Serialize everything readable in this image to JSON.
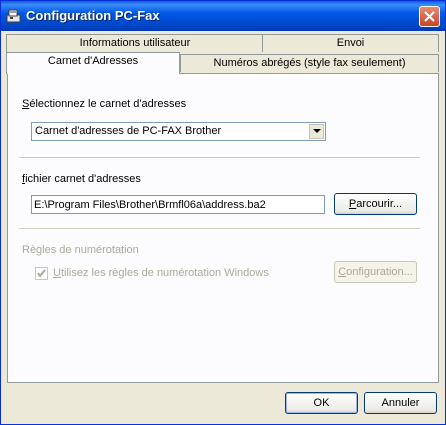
{
  "window": {
    "title": "Configuration PC-Fax",
    "close_label": "✕"
  },
  "tabs": {
    "row1": [
      "Informations utilisateur",
      "Envoi"
    ],
    "row2": [
      "Carnet d'Adresses",
      "Numéros abrégés (style fax seulement)"
    ],
    "active": "Carnet d'Adresses"
  },
  "address_book": {
    "select_label_first": "S",
    "select_label_rest": "électionnez le carnet d'adresses",
    "selected_value": "Carnet d'adresses de PC-FAX Brother",
    "file_label_first": "f",
    "file_label_rest": "ichier carnet d'adresses",
    "file_path": "E:\\Program Files\\Brother\\Brmfl06a\\address.ba2",
    "browse_first": "P",
    "browse_rest": "arcourir..."
  },
  "dialing_rules": {
    "group_label": "Règles de numérotation",
    "checkbox_first": "U",
    "checkbox_rest": "tilisez les règles de numérotation Windows",
    "checkbox_checked": true,
    "config_first": "C",
    "config_rest": "onfiguration..."
  },
  "footer": {
    "ok_label": "OK",
    "cancel_label": "Annuler"
  }
}
